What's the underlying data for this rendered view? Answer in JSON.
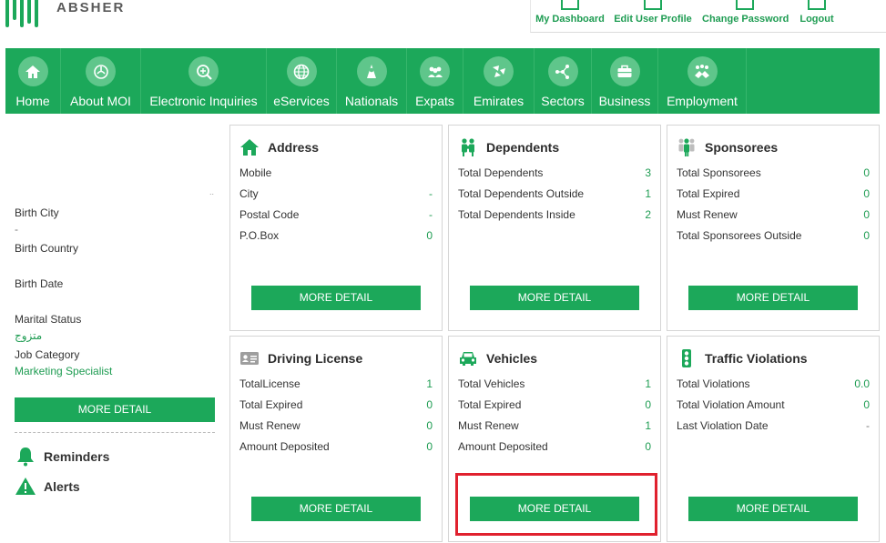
{
  "brand": {
    "name": "ABSHER",
    "green": "#1ca85a",
    "light_green": "#5fc68b",
    "text_green": "#1e9c52"
  },
  "top_links": [
    {
      "label": "My Dashboard",
      "icon": "dashboard-icon"
    },
    {
      "label": "Edit User Profile",
      "icon": "profile-icon"
    },
    {
      "label": "Change Password",
      "icon": "password-icon"
    },
    {
      "label": "Logout",
      "icon": "logout-icon"
    }
  ],
  "nav": [
    {
      "label": "Home",
      "icon": "home-icon"
    },
    {
      "label": "About MOI",
      "icon": "moi-emblem-icon"
    },
    {
      "label": "Electronic Inquiries",
      "icon": "inquiries-icon"
    },
    {
      "label": "eServices",
      "icon": "globe-icon"
    },
    {
      "label": "Nationals",
      "icon": "national-person-icon"
    },
    {
      "label": "Expats",
      "icon": "group-icon"
    },
    {
      "label": "Emirates",
      "icon": "emirates-icon"
    },
    {
      "label": "Sectors",
      "icon": "network-icon"
    },
    {
      "label": "Business",
      "icon": "briefcase-icon"
    },
    {
      "label": "Employment",
      "icon": "handshake-icon"
    }
  ],
  "profile": {
    "dash": "..",
    "birth_city_label": "Birth City",
    "birth_city_value": "-",
    "birth_country_label": "Birth Country",
    "birth_date_label": "Birth Date",
    "marital_status_label": "Marital Status",
    "marital_status_value": "متزوج",
    "job_category_label": "Job Category",
    "job_category_value": "Marketing Specialist",
    "more_detail": "MORE DETAIL"
  },
  "side_links": {
    "reminders": "Reminders",
    "alerts": "Alerts"
  },
  "cards": {
    "address": {
      "title": "Address",
      "rows": [
        {
          "k": "Mobile",
          "v": ""
        },
        {
          "k": "City",
          "v": "-"
        },
        {
          "k": "Postal Code",
          "v": "-"
        },
        {
          "k": "P.O.Box",
          "v": "0"
        }
      ],
      "button": "MORE DETAIL"
    },
    "dependents": {
      "title": "Dependents",
      "rows": [
        {
          "k": "Total Dependents",
          "v": "3"
        },
        {
          "k": "Total Dependents Outside",
          "v": "1"
        },
        {
          "k": "Total Dependents Inside",
          "v": "2"
        }
      ],
      "button": "MORE DETAIL"
    },
    "sponsorees": {
      "title": "Sponsorees",
      "rows": [
        {
          "k": "Total Sponsorees",
          "v": "0"
        },
        {
          "k": "Total Expired",
          "v": "0"
        },
        {
          "k": "Must Renew",
          "v": "0"
        },
        {
          "k": "Total Sponsorees Outside",
          "v": "0"
        }
      ],
      "button": "MORE DETAIL"
    },
    "driving": {
      "title": "Driving License",
      "rows": [
        {
          "k": "TotalLicense",
          "v": "1"
        },
        {
          "k": "Total Expired",
          "v": "0"
        },
        {
          "k": "Must Renew",
          "v": "0"
        },
        {
          "k": "Amount Deposited",
          "v": "0"
        }
      ],
      "button": "MORE DETAIL"
    },
    "vehicles": {
      "title": "Vehicles",
      "rows": [
        {
          "k": "Total Vehicles",
          "v": "1"
        },
        {
          "k": "Total Expired",
          "v": "0"
        },
        {
          "k": "Must Renew",
          "v": "1"
        },
        {
          "k": "Amount Deposited",
          "v": "0"
        }
      ],
      "button": "MORE DETAIL"
    },
    "violations": {
      "title": "Traffic Violations",
      "rows": [
        {
          "k": "Total Violations",
          "v": "0.0"
        },
        {
          "k": "Total Violation Amount",
          "v": "0"
        },
        {
          "k": "Last Violation Date",
          "v": "-"
        }
      ],
      "button": "MORE DETAIL"
    }
  },
  "highlight_color": "#e0212e"
}
